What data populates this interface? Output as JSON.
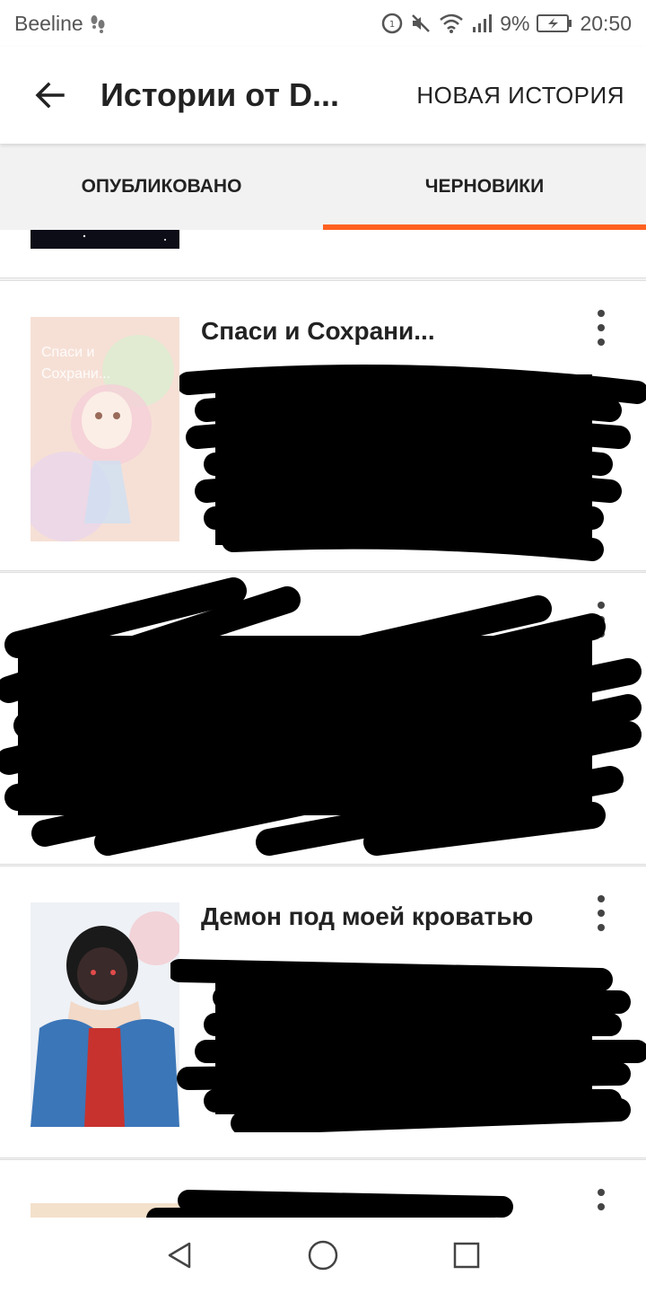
{
  "status_bar": {
    "carrier": "Beeline",
    "battery": "9%",
    "time": "20:50"
  },
  "app_bar": {
    "title": "Истории от D...",
    "new_story_label": "НОВАЯ ИСТОРИЯ"
  },
  "tabs": [
    {
      "label": "ОПУБЛИКОВАНО",
      "active": false
    },
    {
      "label": "ЧЕРНОВИКИ",
      "active": true
    }
  ],
  "stories": [
    {
      "title": ""
    },
    {
      "title": "Спаси и Сохрани...",
      "cover_text": "Спаси и Сохрани..."
    },
    {
      "title": ""
    },
    {
      "title": "Демон под моей кроватью"
    },
    {
      "title": ""
    }
  ],
  "colors": {
    "accent": "#ff6122",
    "text": "#222222",
    "background": "#f2f2f2"
  },
  "icons": {
    "back": "arrow-left-icon",
    "menu": "more-vertical-icon",
    "nav_back": "triangle-back-icon",
    "nav_home": "circle-home-icon",
    "nav_recent": "square-recent-icon"
  }
}
